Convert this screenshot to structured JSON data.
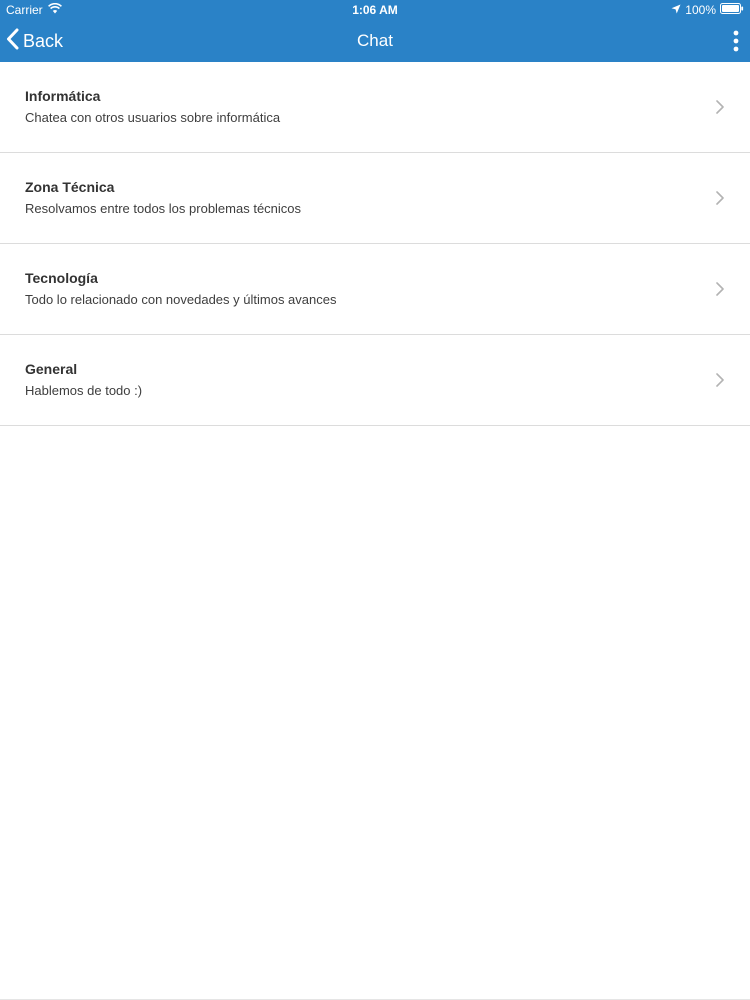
{
  "status_bar": {
    "carrier": "Carrier",
    "time": "1:06 AM",
    "battery": "100%",
    "wifi_icon": "wifi-icon",
    "location_icon": "location-arrow-icon",
    "battery_icon": "battery-icon"
  },
  "nav": {
    "back_label": "Back",
    "back_icon": "chevron-left-icon",
    "title": "Chat",
    "menu_icon": "vertical-ellipsis-icon"
  },
  "chat_rooms": [
    {
      "title": "Informática",
      "subtitle": "Chatea con otros usuarios sobre informática"
    },
    {
      "title": "Zona Técnica",
      "subtitle": "Resolvamos entre todos los problemas técnicos"
    },
    {
      "title": "Tecnología",
      "subtitle": "Todo lo relacionado con novedades y últimos avances"
    },
    {
      "title": "General",
      "subtitle": "Hablemos de todo :)"
    }
  ],
  "colors": {
    "header_background": "#2a82c7",
    "header_text": "#ffffff",
    "item_title": "#333333",
    "item_subtitle": "#3e3e3e",
    "divider": "#dcdcdc",
    "chevron": "#b3b3b3"
  }
}
